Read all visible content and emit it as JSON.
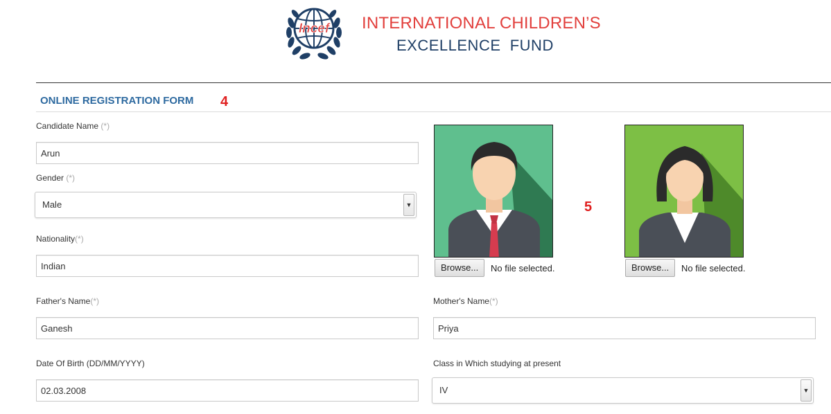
{
  "header": {
    "logo_text": "Incef",
    "org_line1": "INTERNATIONAL CHILDREN’S",
    "org_line2": "EXCELLENCE  FUND",
    "colors": {
      "org_line1": "#e2403d",
      "org_line2": "#1f3f66",
      "logo": "#1f3f66",
      "logo_text": "#e2403d"
    }
  },
  "form": {
    "title": "ONLINE REGISTRATION FORM",
    "title_color": "#2e6aa0",
    "markers": [
      "4",
      "5"
    ],
    "required_mark": "(*)",
    "candidate_name": {
      "label": "Candidate Name",
      "value": "Arun"
    },
    "gender": {
      "label": "Gender",
      "value": "Male"
    },
    "nationality": {
      "label": "Nationality",
      "value": "Indian"
    },
    "fathers_name": {
      "label": "Father's Name",
      "value": "Ganesh"
    },
    "mothers_name": {
      "label": "Mother's Name",
      "value": "Priya"
    },
    "dob": {
      "label": "Date Of Birth (DD/MM/YYYY)",
      "value": "02.03.2008"
    },
    "class": {
      "label": "Class in Which studying at present",
      "value": "IV"
    }
  },
  "uploads": {
    "browse_label": "Browse...",
    "no_file_text": "No file selected.",
    "male_photo": {
      "icon": "male-avatar-icon",
      "bg": "#5fbf8e"
    },
    "female_photo": {
      "icon": "female-avatar-icon",
      "bg": "#7dbf45"
    }
  }
}
